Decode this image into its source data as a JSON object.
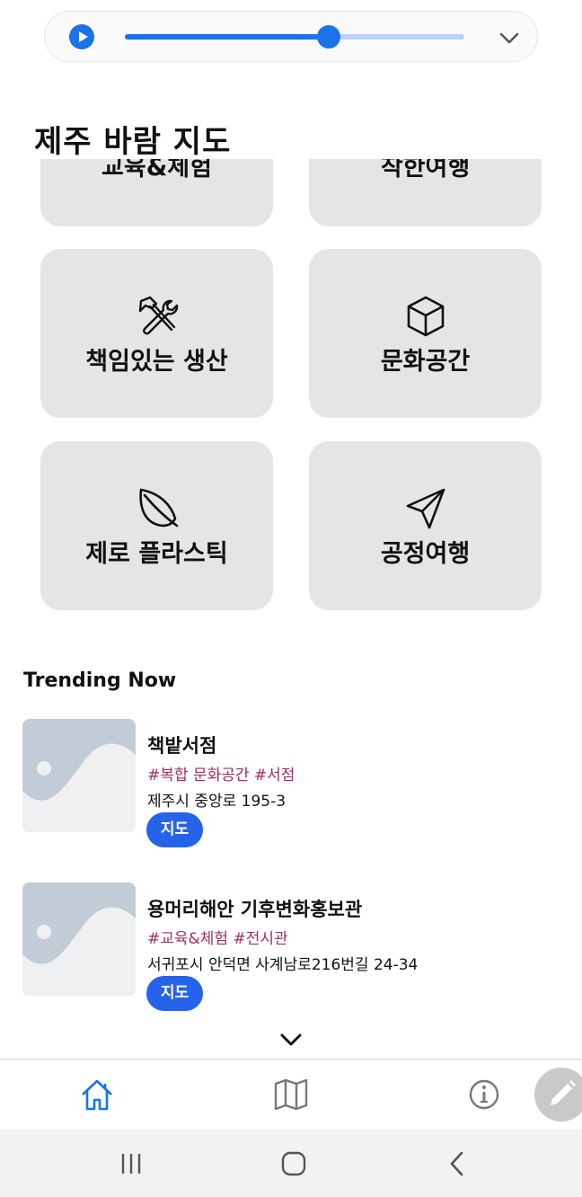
{
  "player": {
    "progress": 0.6,
    "icons": {
      "play": "play-icon",
      "collapse": "chevron-down-icon"
    }
  },
  "app_title": "제주 바람 지도",
  "categories": [
    {
      "label": "교육&체험",
      "icon": "none"
    },
    {
      "label": "착한여행",
      "icon": "none"
    },
    {
      "label": "책임있는 생산",
      "icon": "tools-icon"
    },
    {
      "label": "문화공간",
      "icon": "cube-icon"
    },
    {
      "label": "제로 플라스틱",
      "icon": "leaf-icon"
    },
    {
      "label": "공정여행",
      "icon": "send-icon"
    }
  ],
  "trending": {
    "title": "Trending Now",
    "items": [
      {
        "name": "책밭서점",
        "tags": "#복합 문화공간 #서점",
        "address": "제주시  중앙로 195-3",
        "button": "지도"
      },
      {
        "name": "용머리해안 기후변화홍보관",
        "tags": "#교육&체험 #전시관",
        "address": "서귀포시 안덕면 사계남로216번길 24-34",
        "button": "지도"
      }
    ]
  },
  "nav": {
    "items": [
      "home-icon",
      "map-icon",
      "info-icon"
    ],
    "fab": "pencil-icon"
  },
  "system_bar": [
    "recent-apps-icon",
    "home-circle-icon",
    "back-icon"
  ],
  "colors": {
    "accent": "#1a73e8",
    "button": "#2563eb",
    "tag": "#a02c6b",
    "card": "#e5e6e4"
  }
}
